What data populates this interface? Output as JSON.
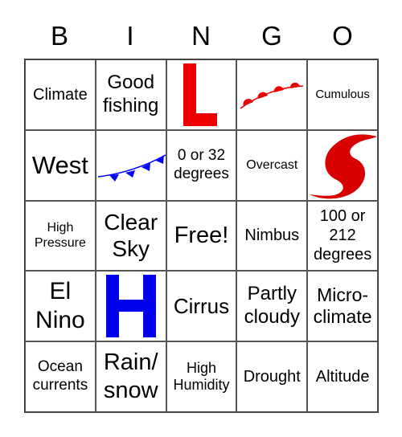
{
  "header": [
    "B",
    "I",
    "N",
    "G",
    "O"
  ],
  "cells": [
    {
      "text": "Climate",
      "size": 20
    },
    {
      "text": "Good fishing",
      "size": 24
    },
    {
      "icon": "warm-front-low-L-icon",
      "letter": "L",
      "color": "#ee0000"
    },
    {
      "icon": "warm-front-icon",
      "color": "#ee0000"
    },
    {
      "text": "Cumulous",
      "size": 15
    },
    {
      "text": "West",
      "size": 31
    },
    {
      "icon": "cold-front-icon",
      "color": "#0000ff"
    },
    {
      "text": "0 or 32 degrees",
      "size": 19
    },
    {
      "text": "Overcast",
      "size": 16
    },
    {
      "icon": "hurricane-icon",
      "color": "#d90000"
    },
    {
      "text": "High Pressure",
      "size": 16
    },
    {
      "text": "Clear Sky",
      "size": 28
    },
    {
      "text": "Free!",
      "size": 29
    },
    {
      "text": "Nimbus",
      "size": 20
    },
    {
      "text": "100 or 212 degrees",
      "size": 20
    },
    {
      "text": "El Nino",
      "size": 30
    },
    {
      "icon": "high-pressure-H-icon",
      "letter": "H",
      "color": "#0000ee"
    },
    {
      "text": "Cirrus",
      "size": 26
    },
    {
      "text": "Partly cloudy",
      "size": 24
    },
    {
      "text": "Micro-climate",
      "size": 23
    },
    {
      "text": "Ocean currents",
      "size": 19
    },
    {
      "text": "Rain/ snow",
      "size": 29
    },
    {
      "text": "High Humidity",
      "size": 18
    },
    {
      "text": "Drought",
      "size": 20
    },
    {
      "text": "Altitude",
      "size": 20
    }
  ]
}
